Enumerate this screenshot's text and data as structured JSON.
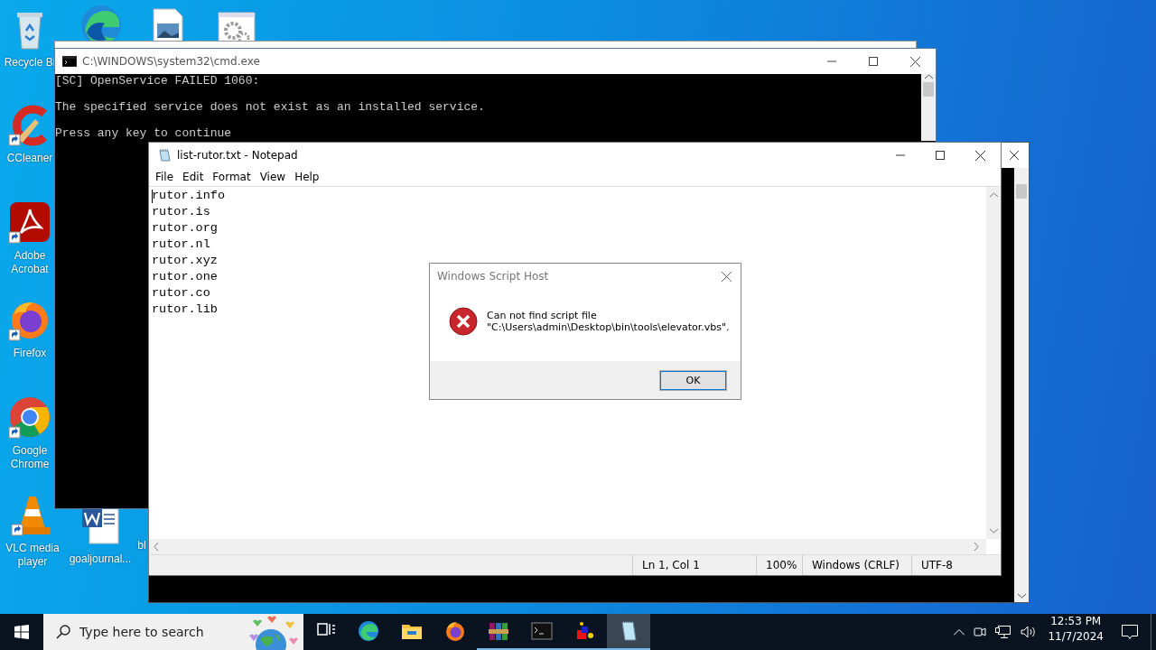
{
  "desktop_icons": [
    {
      "kind": "recycle-bin",
      "label": "Recycle Bi",
      "shortcut": false
    },
    {
      "kind": "edge",
      "shortcut": false
    },
    {
      "kind": "image-file",
      "shortcut": false
    },
    {
      "kind": "settings-file",
      "shortcut": false
    },
    {
      "kind": "ccleaner",
      "label": "CCleaner",
      "shortcut": true
    },
    {
      "kind": "acrobat",
      "label": "Adobe Acrobat",
      "shortcut": true
    },
    {
      "kind": "firefox",
      "label": "Firefox",
      "shortcut": true
    },
    {
      "kind": "chrome",
      "label": "Google Chrome",
      "shortcut": true
    },
    {
      "kind": "vlc",
      "label": "VLC media player",
      "shortcut": true
    },
    {
      "kind": "word",
      "label": "goaljournal...",
      "shortcut": false
    },
    {
      "kind": "hidden",
      "label": "bl"
    }
  ],
  "cmd_window": {
    "title": "C:\\WINDOWS\\system32\\cmd.exe",
    "lines": [
      "[SC] OpenService FAILED 1060:",
      "The specified service does not exist as an installed service.",
      "Press any key to continue"
    ]
  },
  "notepad": {
    "title": "list-rutor.txt - Notepad",
    "menu": [
      "File",
      "Edit",
      "Format",
      "View",
      "Help"
    ],
    "lines": [
      "rutor.info",
      "rutor.is",
      "rutor.org",
      "rutor.nl",
      "rutor.xyz",
      "rutor.one",
      "rutor.co",
      "rutor.lib"
    ],
    "status": [
      "Ln 1, Col 1",
      "100%",
      "Windows (CRLF)",
      "UTF-8"
    ]
  },
  "dialog": {
    "title": "Windows Script Host",
    "message": [
      "Can not find script file",
      "\"C:\\Users\\admin\\Desktop\\bin\\tools\\elevator.vbs\"."
    ],
    "button": "OK"
  },
  "taskbar": {
    "search_placeholder": "Type here to search",
    "apps": [
      {
        "kind": "task-view",
        "running": false,
        "active": false
      },
      {
        "kind": "edge",
        "running": false,
        "active": false
      },
      {
        "kind": "explorer",
        "running": false,
        "active": false
      },
      {
        "kind": "firefox",
        "running": false,
        "active": false
      },
      {
        "kind": "winrar",
        "running": true,
        "active": false
      },
      {
        "kind": "cmd",
        "running": true,
        "active": false
      },
      {
        "kind": "app",
        "running": true,
        "active": false
      },
      {
        "kind": "notepad",
        "running": true,
        "active": true
      }
    ],
    "time": "12:53 PM",
    "date": "11/7/2024"
  }
}
